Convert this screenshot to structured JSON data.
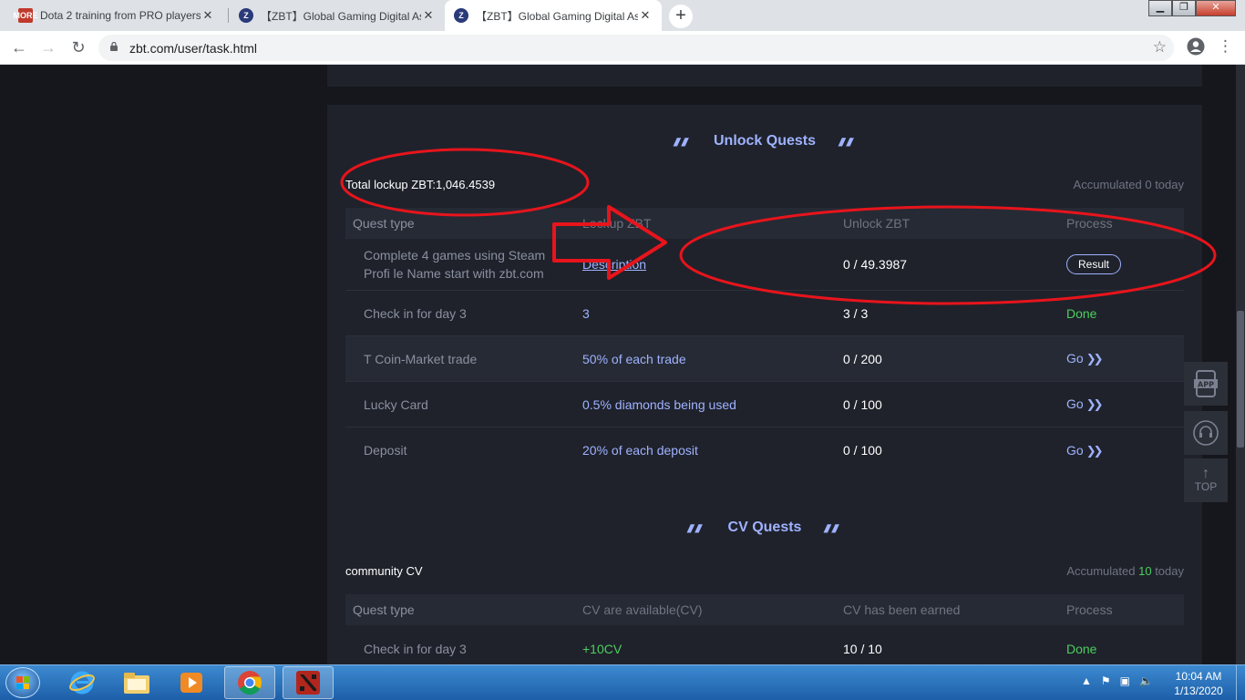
{
  "browser": {
    "tabs": [
      {
        "title": "Dota 2 training from PRO players",
        "favicon_text": "MORE"
      },
      {
        "title": "【ZBT】Global Gaming Digital Asse",
        "favicon_text": "Z"
      },
      {
        "title": "【ZBT】Global Gaming Digital Asse",
        "favicon_text": "Z"
      }
    ],
    "new_tab_symbol": "+",
    "url": "zbt.com/user/task.html"
  },
  "unlock_quests": {
    "title": "Unlock Quests",
    "total_lockup": "Total lockup ZBT:1,046.4539",
    "accumulated_prefix": "Accumulated",
    "accumulated_value": "0",
    "accumulated_suffix": "today",
    "headers": [
      "Quest type",
      "Lockup ZBT",
      "Unlock ZBT",
      "Process"
    ],
    "rows": [
      {
        "type": "Complete 4 games using Steam Profi le Name start with zbt.com",
        "lockup": "Description",
        "unlock": "0 / 49.3987",
        "process": "Result"
      },
      {
        "type": "Check in for day 3",
        "lockup": "3",
        "unlock": "3 / 3",
        "process": "Done"
      },
      {
        "type": "T Coin-Market trade",
        "lockup": "50% of each trade",
        "unlock": "0 / 200",
        "process": "Go"
      },
      {
        "type": "Lucky Card",
        "lockup": "0.5% diamonds being used",
        "unlock": "0 / 100",
        "process": "Go"
      },
      {
        "type": "Deposit",
        "lockup": "20% of each deposit",
        "unlock": "0 / 100",
        "process": "Go"
      }
    ]
  },
  "cv_quests": {
    "title": "CV Quests",
    "label": "community CV",
    "accumulated_prefix": "Accumulated",
    "accumulated_value": "10",
    "accumulated_suffix": "today",
    "headers": [
      "Quest type",
      "CV are available(CV)",
      "CV has been earned",
      "Process"
    ],
    "rows": [
      {
        "type": "Check in for day 3",
        "available": "+10CV",
        "earned": "10 / 10",
        "process": "Done"
      }
    ]
  },
  "side_buttons": {
    "app": "APP",
    "top": "TOP"
  },
  "taskbar": {
    "time": "10:04 AM",
    "date": "1/13/2020"
  },
  "colors": {
    "accent": "#9fb2ff",
    "done": "#4ccf5d",
    "panel": "#1f222b",
    "annotation": "#e8141c"
  }
}
